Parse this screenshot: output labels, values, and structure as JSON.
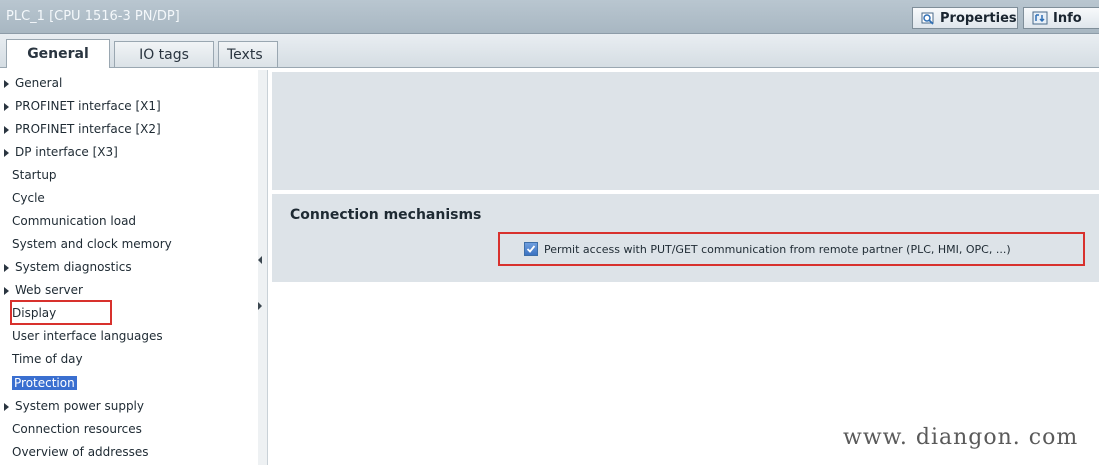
{
  "window": {
    "title": "PLC_1 [CPU 1516-3 PN/DP]",
    "properties_label": "Properties",
    "info_label": "Info"
  },
  "tabs": [
    {
      "label": "General"
    },
    {
      "label": "IO tags"
    },
    {
      "label": "Texts"
    }
  ],
  "nav": {
    "items": [
      {
        "label": "General",
        "expandable": true
      },
      {
        "label": "PROFINET interface [X1]",
        "expandable": true
      },
      {
        "label": "PROFINET interface [X2]",
        "expandable": true
      },
      {
        "label": "DP interface [X3]",
        "expandable": true
      },
      {
        "label": "Startup",
        "expandable": false
      },
      {
        "label": "Cycle",
        "expandable": false
      },
      {
        "label": "Communication load",
        "expandable": false
      },
      {
        "label": "System and clock memory",
        "expandable": false
      },
      {
        "label": "System diagnostics",
        "expandable": true
      },
      {
        "label": "Web server",
        "expandable": true
      },
      {
        "label": "Display",
        "expandable": false
      },
      {
        "label": "User interface languages",
        "expandable": false
      },
      {
        "label": "Time of day",
        "expandable": false
      },
      {
        "label": "Protection",
        "expandable": false,
        "selected": true
      },
      {
        "label": "System power supply",
        "expandable": true
      },
      {
        "label": "Connection resources",
        "expandable": false
      },
      {
        "label": "Overview of addresses",
        "expandable": false
      }
    ]
  },
  "content": {
    "section_title": "Connection mechanisms",
    "checkbox_label": "Permit access with PUT/GET communication from remote partner (PLC, HMI, OPC, ...)",
    "checkbox_checked": true
  },
  "watermark": "www. diangon. com",
  "colors": {
    "selection": "#3a6fd0",
    "highlight_box": "#d8312d",
    "panel_bg": "#dde3e8"
  }
}
